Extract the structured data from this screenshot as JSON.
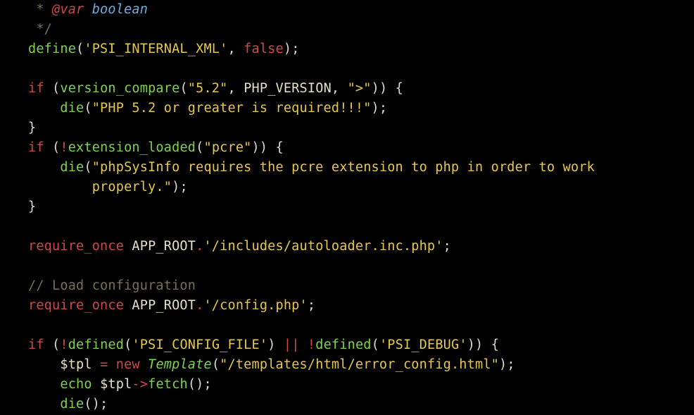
{
  "code": {
    "l1_star": " * ",
    "l1_at": "@var",
    "l1_sp": " ",
    "l1_type": "boolean",
    "l2": " */",
    "l3_fn": "define",
    "l3_p1": "(",
    "l3_s": "'PSI_INTERNAL_XML'",
    "l3_c": ", ",
    "l3_v": "false",
    "l3_p2": ");",
    "l5_if": "if",
    "l5_sp": " ",
    "l5_p1": "(",
    "l5_fn": "version_compare",
    "l5_p2": "(",
    "l5_s1": "\"5.2\"",
    "l5_c1": ", ",
    "l5_con": "PHP_VERSION",
    "l5_c2": ", ",
    "l5_s2": "\">\"",
    "l5_p3": ")) {",
    "l6_ind": "    ",
    "l6_fn": "die",
    "l6_p1": "(",
    "l6_s": "\"PHP 5.2 or greater is required!!!\"",
    "l6_p2": ");",
    "l7": "}",
    "l8_if": "if",
    "l8_sp": " ",
    "l8_p1": "(",
    "l8_not": "!",
    "l8_fn": "extension_loaded",
    "l8_p2": "(",
    "l8_s": "\"pcre\"",
    "l8_p3": ")) {",
    "l9_ind": "    ",
    "l9_fn": "die",
    "l9_p1": "(",
    "l9_s": "\"phpSysInfo requires the pcre extension to php in order to work",
    "l10_ind": "        ",
    "l10_s": "properly.\"",
    "l10_p": ");",
    "l11": "}",
    "l13_kw": "require_once",
    "l13_sp": " ",
    "l13_con": "APP_ROOT",
    "l13_dot": ".",
    "l13_s": "'/includes/autoloader.inc.php'",
    "l13_p": ";",
    "l15": "// Load configuration",
    "l16_kw": "require_once",
    "l16_sp": " ",
    "l16_con": "APP_ROOT",
    "l16_dot": ".",
    "l16_s": "'/config.php'",
    "l16_p": ";",
    "l18_if": "if",
    "l18_sp": " ",
    "l18_p1": "(",
    "l18_n1": "!",
    "l18_fn1": "defined",
    "l18_p2": "(",
    "l18_s1": "'PSI_CONFIG_FILE'",
    "l18_p3": ") ",
    "l18_or": "||",
    "l18_sp2": " ",
    "l18_n2": "!",
    "l18_fn2": "defined",
    "l18_p4": "(",
    "l18_s2": "'PSI_DEBUG'",
    "l18_p5": ")) {",
    "l19_ind": "    ",
    "l19_var": "$tpl",
    "l19_sp1": " ",
    "l19_eq": "=",
    "l19_sp2": " ",
    "l19_new": "new",
    "l19_sp3": " ",
    "l19_cls": "Template",
    "l19_p1": "(",
    "l19_s": "\"/templates/html/error_config.html\"",
    "l19_p2": ");",
    "l20_ind": "    ",
    "l20_echo": "echo",
    "l20_sp": " ",
    "l20_var": "$tpl",
    "l20_arr": "->",
    "l20_fn": "fetch",
    "l20_p": "();",
    "l21_ind": "    ",
    "l21_fn": "die",
    "l21_p": "();"
  }
}
